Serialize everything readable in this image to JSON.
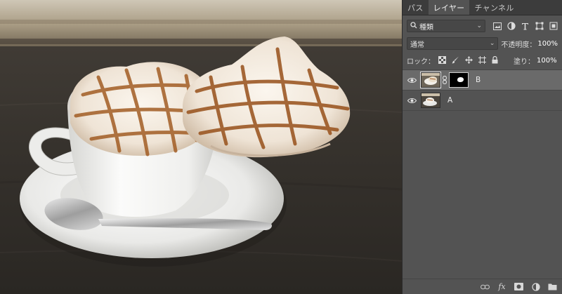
{
  "panel": {
    "tabs": [
      {
        "label": "パス"
      },
      {
        "label": "レイヤー"
      },
      {
        "label": "チャンネル"
      }
    ],
    "filter": {
      "kind_label": "種類",
      "icons": [
        "pixel-filter-icon",
        "adjustment-filter-icon",
        "type-filter-icon",
        "shape-filter-icon",
        "smart-object-filter-icon"
      ]
    },
    "blend_mode": "通常",
    "opacity_label": "不透明度：",
    "opacity_value": "100%",
    "lock_label": "ロック：",
    "fill_label": "塗り：",
    "fill_value": "100%",
    "layers": [
      {
        "name": "B",
        "visible": true,
        "selected": true,
        "has_mask": true
      },
      {
        "name": "A",
        "visible": true,
        "selected": false,
        "has_mask": false
      }
    ],
    "bottom_icons": [
      "link-layers-icon",
      "fx-icon",
      "add-mask-icon",
      "adjustment-layer-icon",
      "new-group-icon"
    ],
    "fx_text": "fx"
  }
}
